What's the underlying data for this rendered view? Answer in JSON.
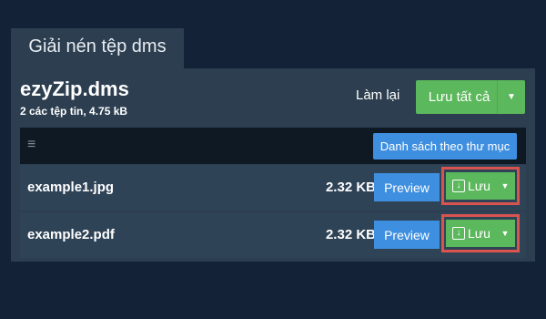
{
  "tab": {
    "title": "Giải nén tệp dms"
  },
  "archive": {
    "name": "ezyZip.dms",
    "meta": "2 các tệp tin, 4.75 kB"
  },
  "actions": {
    "relist_label": "Làm lại",
    "save_all_label": "Lưu tất cả"
  },
  "toolbar": {
    "menu_icon": "≡",
    "list_view_label": "Danh sách theo thư mục"
  },
  "files": [
    {
      "name": "example1.jpg",
      "size": "2.32 KB",
      "preview_label": "Preview",
      "save_label": "Lưu"
    },
    {
      "name": "example2.pdf",
      "size": "2.32 KB",
      "preview_label": "Preview",
      "save_label": "Lưu"
    }
  ],
  "colors": {
    "background": "#142238",
    "panel": "#2c3e50",
    "green": "#5cb85c",
    "blue": "#3f8fe0",
    "highlight": "#d9534f"
  },
  "icons": {
    "menu": "hamburger-icon",
    "download": "download-icon",
    "caret": "caret-down-icon"
  }
}
